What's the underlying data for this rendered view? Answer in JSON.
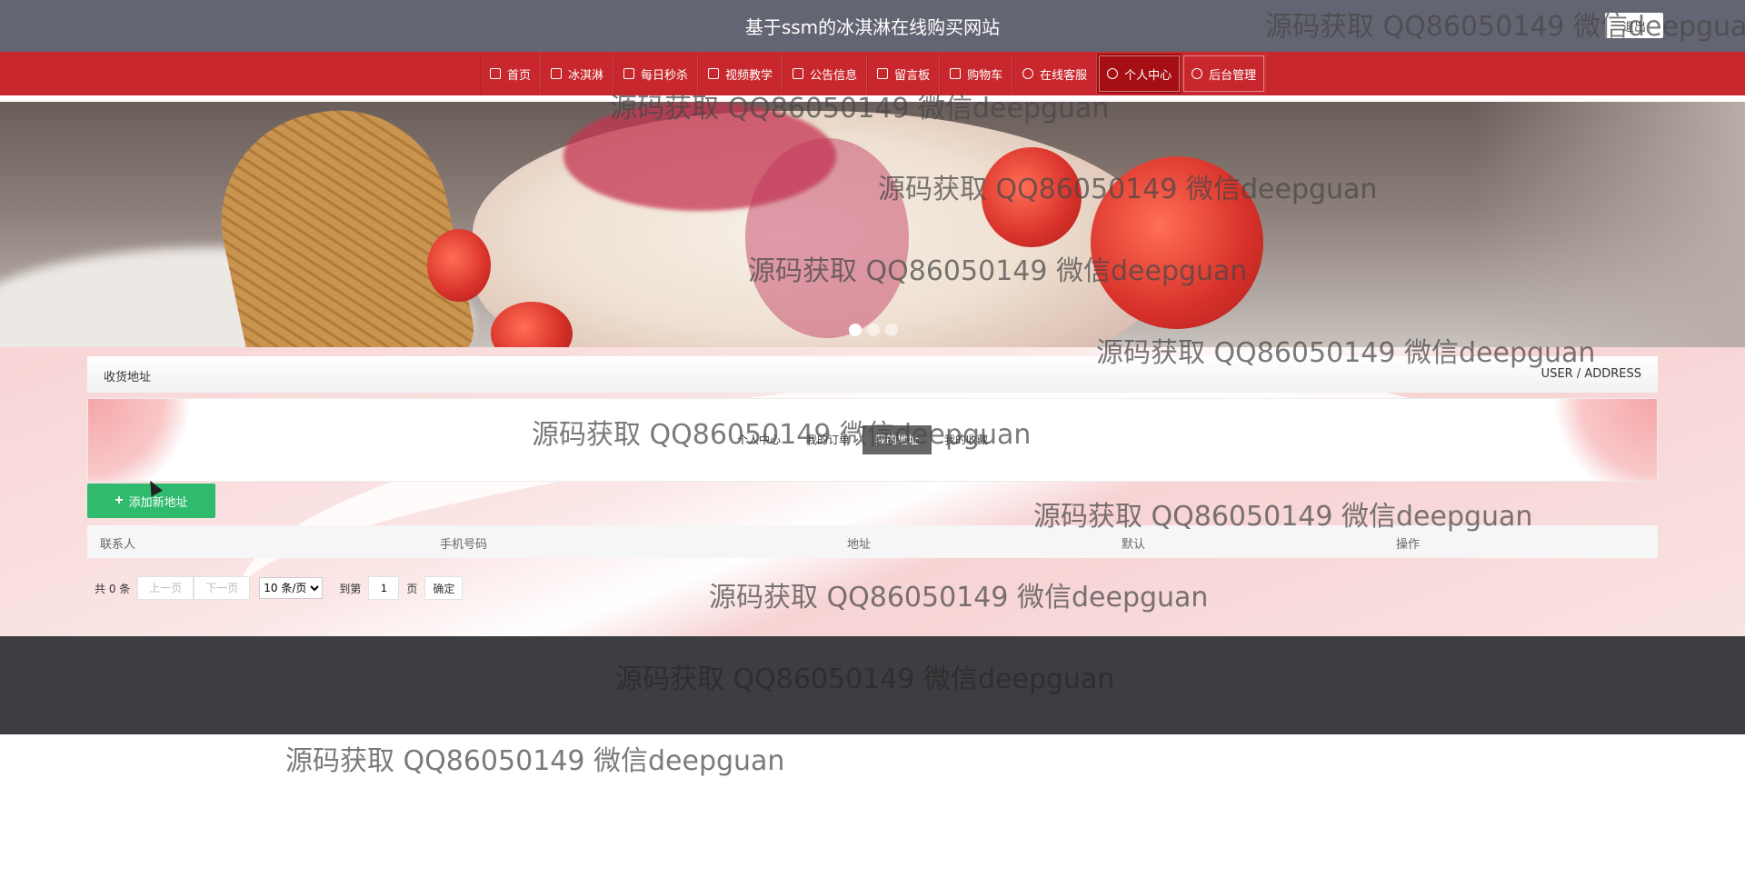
{
  "header": {
    "title": "基于ssm的冰淇淋在线购买网站",
    "logout_label": "退出"
  },
  "nav": {
    "items": [
      {
        "label": "首页",
        "icon": "home-icon"
      },
      {
        "label": "冰淇淋",
        "icon": "layers-icon"
      },
      {
        "label": "每日秒杀",
        "icon": "calendar-icon"
      },
      {
        "label": "视频教学",
        "icon": "grid-icon"
      },
      {
        "label": "公告信息",
        "icon": "mail-icon"
      },
      {
        "label": "留言板",
        "icon": "clipboard-icon"
      },
      {
        "label": "购物车",
        "icon": "cart-icon"
      },
      {
        "label": "在线客服",
        "icon": "chat-icon"
      },
      {
        "label": "个人中心",
        "icon": "user-icon",
        "active": true
      },
      {
        "label": "后台管理",
        "icon": "link-icon"
      }
    ]
  },
  "banner": {
    "slides": 3,
    "active_slide": 1
  },
  "breadcrumb": {
    "left": "收货地址",
    "right": "USER / ADDRESS"
  },
  "tabs": {
    "items": [
      "个人中心",
      "我的订单",
      "我的地址",
      "我的收藏"
    ],
    "active": "我的地址"
  },
  "actions": {
    "add_label": "添加新地址"
  },
  "table": {
    "columns": [
      "联系人",
      "手机号码",
      "地址",
      "默认",
      "操作"
    ],
    "rows": []
  },
  "pager": {
    "total": "共 0 条",
    "prev": "上一页",
    "next": "下一页",
    "page_size_options": [
      "10 条/页"
    ],
    "page_size": "10 条/页",
    "goto": "到第",
    "current_page": "1",
    "unit": "页",
    "confirm": "确定"
  },
  "watermark": {
    "text": "源码获取 QQ86050149 微信deepguan"
  },
  "colors": {
    "topbar": "#646572",
    "nav": "#c8282d",
    "nav_active": "#a50f14",
    "add_button": "#2fba6d",
    "footer": "#3c3e41"
  }
}
